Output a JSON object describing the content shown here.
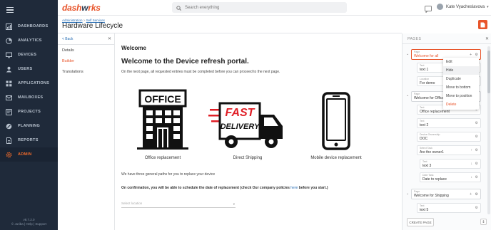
{
  "app": {
    "logo_a": "dash",
    "logo_b": "w",
    "logo_c": "rks"
  },
  "search": {
    "placeholder": "Search everything"
  },
  "user": {
    "name": "Kate Vyacheslavova"
  },
  "nav": {
    "items": [
      {
        "label": "DASHBOARDS",
        "icon": "dashboard-icon"
      },
      {
        "label": "ANALYTICS",
        "icon": "analytics-icon"
      },
      {
        "label": "DEVICES",
        "icon": "monitor-icon"
      },
      {
        "label": "USERS",
        "icon": "user-icon"
      },
      {
        "label": "APPLICATIONS",
        "icon": "apps-icon"
      },
      {
        "label": "MAILBOXES",
        "icon": "mail-icon"
      },
      {
        "label": "PROJECTS",
        "icon": "projects-icon"
      },
      {
        "label": "PLANNING",
        "icon": "planning-icon"
      },
      {
        "label": "REPORTS",
        "icon": "reports-icon"
      },
      {
        "label": "ADMIN",
        "icon": "gear-icon"
      }
    ],
    "version": "v8.7.2.0",
    "footer": "© Juriba | Help | Support"
  },
  "header": {
    "bc1": "Administration",
    "bc_sep": " > ",
    "bc2": "Self Services",
    "title": "Hardware Lifecycle"
  },
  "subnav": {
    "back": "< Back",
    "items": [
      "Details",
      "Builder",
      "Translations"
    ]
  },
  "content": {
    "welcome": "Welcome",
    "heading": "Welcome to the Device refresh portal.",
    "intro": "On the next page, all requested entries must be completed before you can proceed to the next page.",
    "cards": [
      "Office replacement",
      "Direct Shipping",
      "Mobile device replacement"
    ],
    "office_word": "OFFICE",
    "fast_word": "FAST",
    "delivery_word": "DELIVERY",
    "paths": "We have three general paths for you to replace your device",
    "confirm_b": "On confirmation, you will be able to schedule the date of replacement (check Our company policies ",
    "confirm_link": "here",
    "confirm_end": " before you start.)",
    "select_placeholder": "Select location"
  },
  "panel": {
    "title": "PAGES",
    "page_label": "Page",
    "text_label": "Text",
    "location_label": "Location",
    "ownership_label": "Device Ownership",
    "select_task_label": "Select Task",
    "date_task_label": "Date Task",
    "pages": [
      "Welcome for all",
      "Welcome for Office",
      "Welcome for Shipping"
    ],
    "fields_p1": [
      "text 1",
      "For demo"
    ],
    "fields_p2": [
      "Office replacement",
      "text 2",
      "DOC",
      "Are the owner1",
      "text 3",
      "Date to replace"
    ],
    "fields_p3": [
      "text 5"
    ],
    "create": "CREATE PAGE"
  },
  "menu": {
    "items": [
      "Edit",
      "Hide",
      "Duplicate",
      "Move to bottom",
      "Move to position",
      "Delete"
    ]
  }
}
